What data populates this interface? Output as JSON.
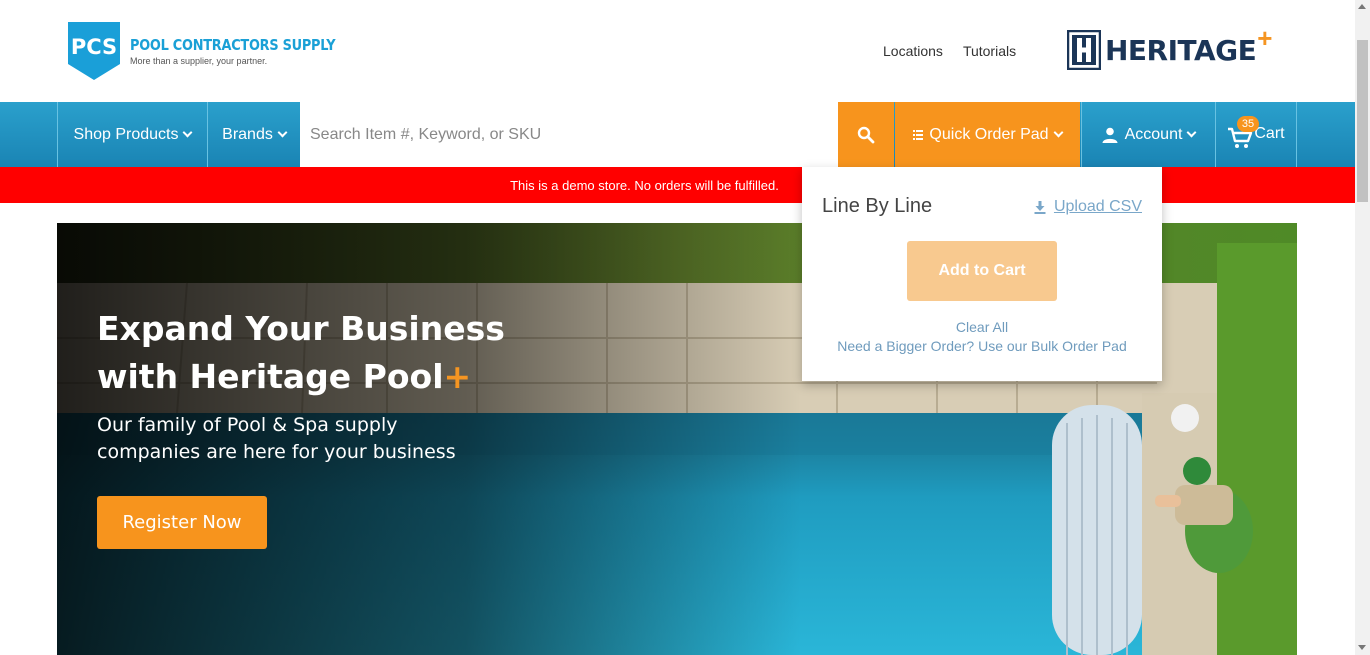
{
  "header": {
    "logo": {
      "initials": "PCS",
      "name": "POOL CONTRACTORS SUPPLY",
      "tagline": "More than a supplier, your partner."
    },
    "links": [
      "Locations",
      "Tutorials"
    ],
    "partner_logo": {
      "text": "HERITAGE",
      "plus": "+"
    }
  },
  "nav": {
    "shop_products": "Shop Products",
    "brands": "Brands",
    "search_placeholder": "Search Item #, Keyword, or SKU",
    "quick_order_pad": "Quick Order Pad",
    "account": "Account",
    "cart_label": "Cart",
    "cart_count": "35"
  },
  "banner": {
    "text": "This is a demo store. No orders will be fulfilled."
  },
  "hero": {
    "title_line1": "Expand Your Business",
    "title_line2": "with Heritage Pool",
    "title_plus": "+",
    "subtitle": "Our family of Pool & Spa supply companies  are here for your business",
    "cta": "Register Now"
  },
  "quick_order_dropdown": {
    "title": "Line By Line",
    "upload": "Upload CSV",
    "add_to_cart": "Add to Cart",
    "clear_all": "Clear All",
    "bulk_link": "Need a Bigger Order? Use our Bulk Order Pad"
  },
  "colors": {
    "nav_blue": "#1f93c4",
    "accent_orange": "#f7941d",
    "banner_red": "#ff0000",
    "heritage_navy": "#1b3557"
  }
}
